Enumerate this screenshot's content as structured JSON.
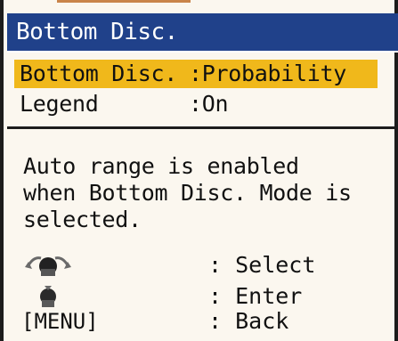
{
  "title": "Bottom Disc.",
  "menu": {
    "items": [
      {
        "label": "Bottom Disc.",
        "value": ":Probability",
        "selected": true
      },
      {
        "label": "Legend",
        "value": ":On",
        "selected": false
      }
    ]
  },
  "description": {
    "lines": [
      "Auto range is enabled",
      "when Bottom Disc. Mode is",
      "selected."
    ]
  },
  "help": [
    {
      "icon": "rotary-knob-rotate-icon",
      "text": ": Select"
    },
    {
      "icon": "rotary-knob-push-icon",
      "text": ": Enter"
    },
    {
      "key_label": "[MENU]",
      "text": ": Back"
    }
  ],
  "colors": {
    "title_bar": "#20418a",
    "selected_row": "#f0b81b",
    "background": "#fbf7ef",
    "frame": "#1c1c1c"
  }
}
